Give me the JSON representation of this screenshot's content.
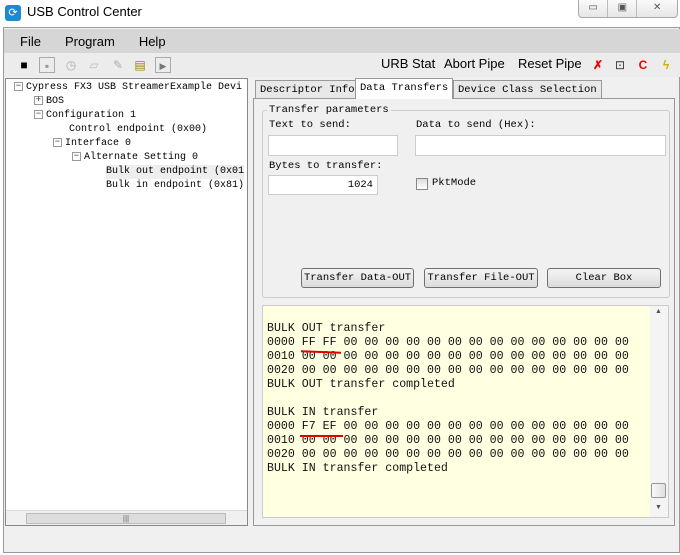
{
  "window": {
    "title": "USB Control Center",
    "min": "▭",
    "max": "▣",
    "close": "✕"
  },
  "menu": [
    "File",
    "Program",
    "Help"
  ],
  "toolbar": {
    "urb_stat": "URB Stat",
    "abort_pipe": "Abort Pipe",
    "reset_pipe": "Reset Pipe"
  },
  "tree": [
    {
      "label": "Cypress FX3 USB StreamerExample Devi",
      "toggle": "−"
    },
    {
      "label": "BOS",
      "toggle": "+"
    },
    {
      "label": "Configuration 1",
      "toggle": "−"
    },
    {
      "label": "Control endpoint (0x00)",
      "toggle": ""
    },
    {
      "label": "Interface 0",
      "toggle": "−"
    },
    {
      "label": "Alternate Setting 0",
      "toggle": "−"
    },
    {
      "label": "Bulk out endpoint (0x01",
      "toggle": ""
    },
    {
      "label": "Bulk in endpoint (0x81)",
      "toggle": ""
    }
  ],
  "tabs": [
    "Descriptor Info",
    "Data Transfers",
    "Device Class Selection"
  ],
  "transfer": {
    "group_title": "Transfer parameters",
    "text_label": "Text to send:",
    "text_value": "",
    "hex_label": "Data to send (Hex):",
    "hex_value": "",
    "bytes_label": "Bytes to transfer:",
    "bytes_value": "1024",
    "pktmode_label": "PktMode",
    "pktmode_checked": false,
    "btn_data_out": "Transfer Data-OUT",
    "btn_file_out": "Transfer File-OUT",
    "btn_clear": "Clear Box"
  },
  "log": [
    "",
    "BULK OUT transfer",
    "0000 FF FF 00 00 00 00 00 00 00 00 00 00 00 00 00 00",
    "0010 00 00 00 00 00 00 00 00 00 00 00 00 00 00 00 00",
    "0020 00 00 00 00 00 00 00 00 00 00 00 00 00 00 00 00",
    "BULK OUT transfer completed",
    "",
    "BULK IN transfer",
    "0000 F7 EF 00 00 00 00 00 00 00 00 00 00 00 00 00 00",
    "0010 00 00 00 00 00 00 00 00 00 00 00 00 00 00 00 00",
    "0020 00 00 00 00 00 00 00 00 00 00 00 00 00 00 00 00",
    "BULK IN transfer completed"
  ],
  "colors": {
    "log_bg": "#ffffe1",
    "annotation": "#e00000"
  }
}
